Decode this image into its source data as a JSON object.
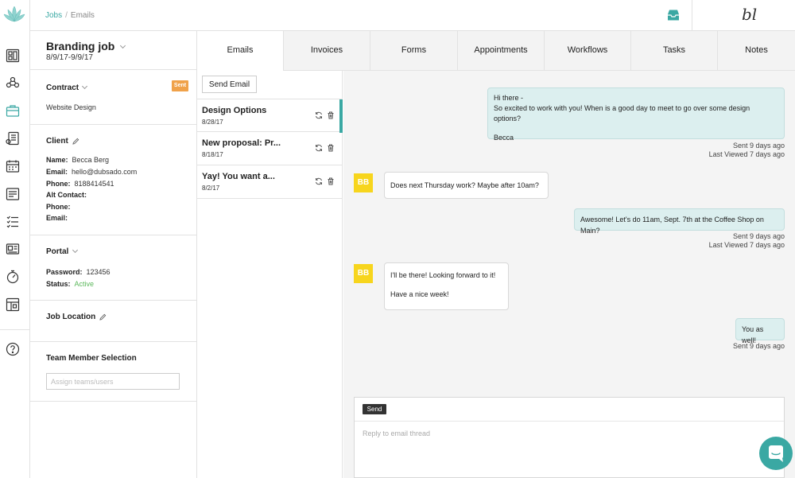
{
  "breadcrumb": {
    "root": "Jobs",
    "current": "Emails"
  },
  "brand": {
    "mark": "bl"
  },
  "colors": {
    "accent": "#3aa8a3",
    "badge": "#f0a24a",
    "avatar": "#f7d51d",
    "active": "#5cb85c"
  },
  "job": {
    "title": "Branding job",
    "dates": "8/9/17-9/9/17"
  },
  "contract": {
    "title": "Contract",
    "status_badge": "Sent",
    "name": "Website Design"
  },
  "client": {
    "title": "Client",
    "fields": [
      {
        "label": "Name:",
        "value": "Becca Berg"
      },
      {
        "label": "Email:",
        "value": "hello@dubsado.com"
      },
      {
        "label": "Phone:",
        "value": "8188414541"
      },
      {
        "label": "Alt Contact:",
        "value": ""
      },
      {
        "label": "Phone:",
        "value": ""
      },
      {
        "label": "Email:",
        "value": ""
      }
    ]
  },
  "portal": {
    "title": "Portal",
    "password_label": "Password:",
    "password": "123456",
    "status_label": "Status:",
    "status": "Active"
  },
  "job_location": {
    "title": "Job Location"
  },
  "team": {
    "title": "Team Member Selection",
    "placeholder": "Assign teams/users"
  },
  "tabs": [
    "Emails",
    "Invoices",
    "Forms",
    "Appointments",
    "Workflows",
    "Tasks",
    "Notes"
  ],
  "email_list": {
    "send_label": "Send Email",
    "items": [
      {
        "subject": "Design Options",
        "date": "8/28/17"
      },
      {
        "subject": "New proposal: Pr...",
        "date": "8/18/17"
      },
      {
        "subject": "Yay! You want a...",
        "date": "8/2/17"
      }
    ]
  },
  "thread": {
    "messages": [
      {
        "from": "me",
        "lines": [
          "Hi there -",
          "So excited to work with you!  When is a good day to meet to go over some design options?",
          "",
          "Becca"
        ],
        "sent": "Sent 9 days ago",
        "viewed": "Last Viewed 7 days ago"
      },
      {
        "from": "them",
        "avatar": "BB",
        "lines": [
          "Does next Thursday work?  Maybe after 10am?"
        ]
      },
      {
        "from": "me",
        "lines": [
          "Awesome! Let's do 11am, Sept. 7th at the Coffee Shop on Main?"
        ],
        "sent": "Sent 9 days ago",
        "viewed": "Last Viewed 7 days ago"
      },
      {
        "from": "them",
        "avatar": "BB",
        "lines": [
          "I'll be there! Looking forward to it!",
          "",
          "Have a nice week!"
        ]
      },
      {
        "from": "me",
        "lines": [
          "You as well!"
        ],
        "sent": "Sent 9 days ago"
      }
    ],
    "reply": {
      "send_label": "Send",
      "placeholder": "Reply to email thread"
    }
  },
  "icons": {
    "rail": [
      "logo-lotus-icon",
      "dashboard-icon",
      "contacts-icon",
      "jobs-icon",
      "invoices-icon",
      "calendar-icon",
      "forms-icon",
      "tasks-icon",
      "templates-icon",
      "time-icon",
      "reports-icon",
      "help-icon"
    ],
    "top": [
      "inbox-icon"
    ],
    "email_row": [
      "refresh-icon",
      "trash-icon"
    ]
  }
}
